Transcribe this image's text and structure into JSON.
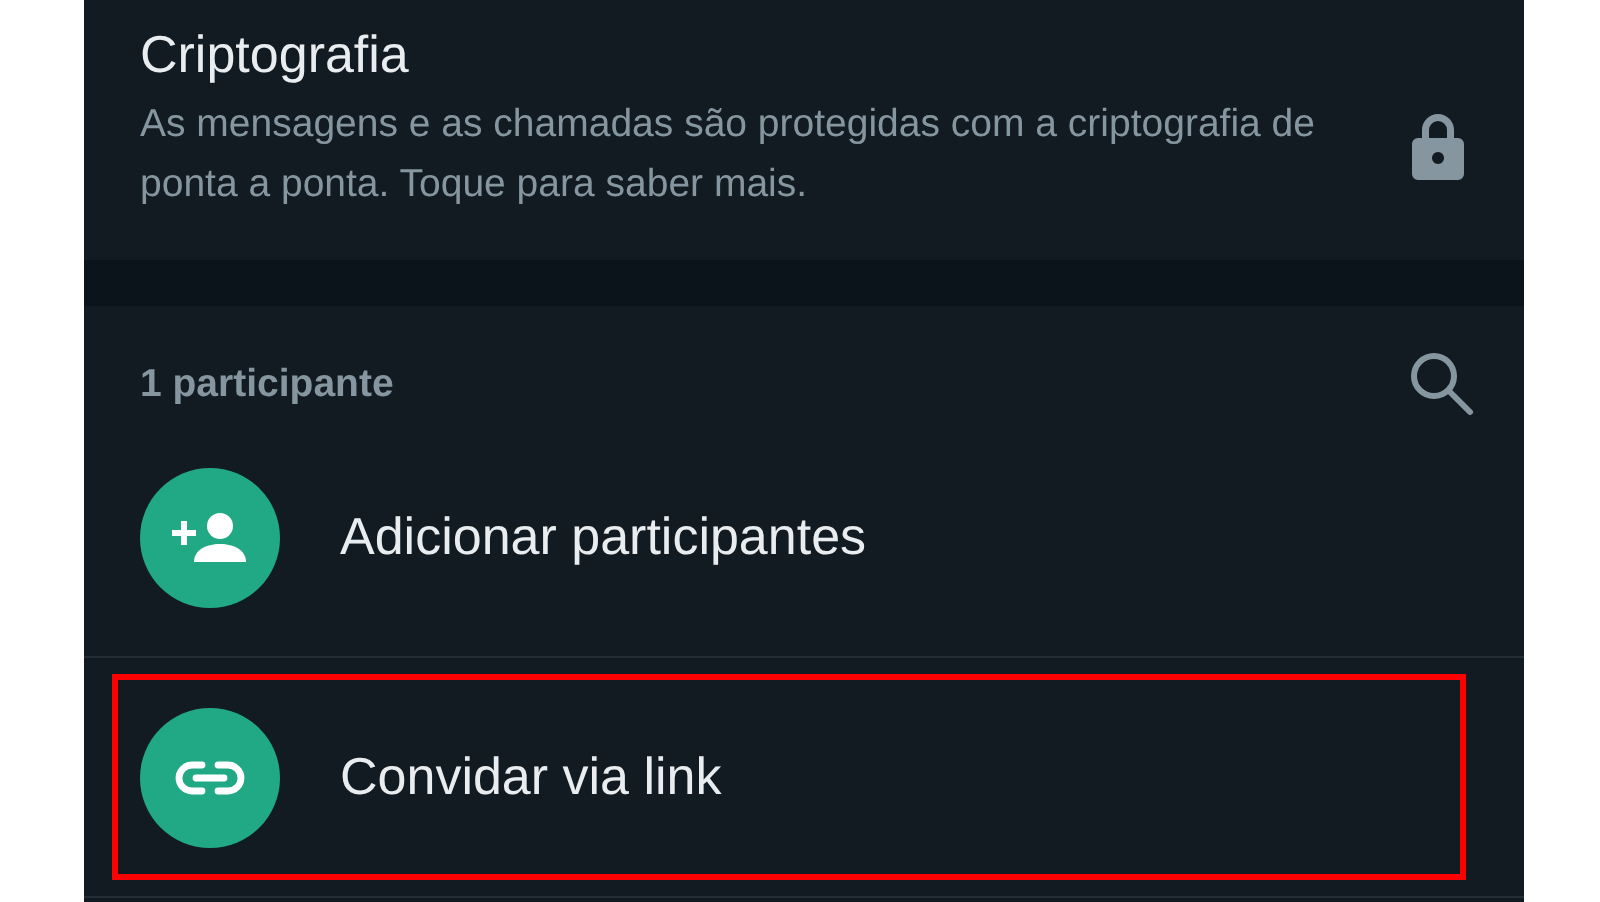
{
  "encryption": {
    "title": "Criptografia",
    "description": "As mensagens e as chamadas são protegidas com a criptografia de ponta a ponta. Toque para saber mais."
  },
  "participants": {
    "heading": "1 participante"
  },
  "actions": [
    {
      "kind": "add",
      "label": "Adicionar participantes",
      "highlighted": false
    },
    {
      "kind": "link",
      "label": "Convidar via link",
      "highlighted": true
    }
  ]
}
